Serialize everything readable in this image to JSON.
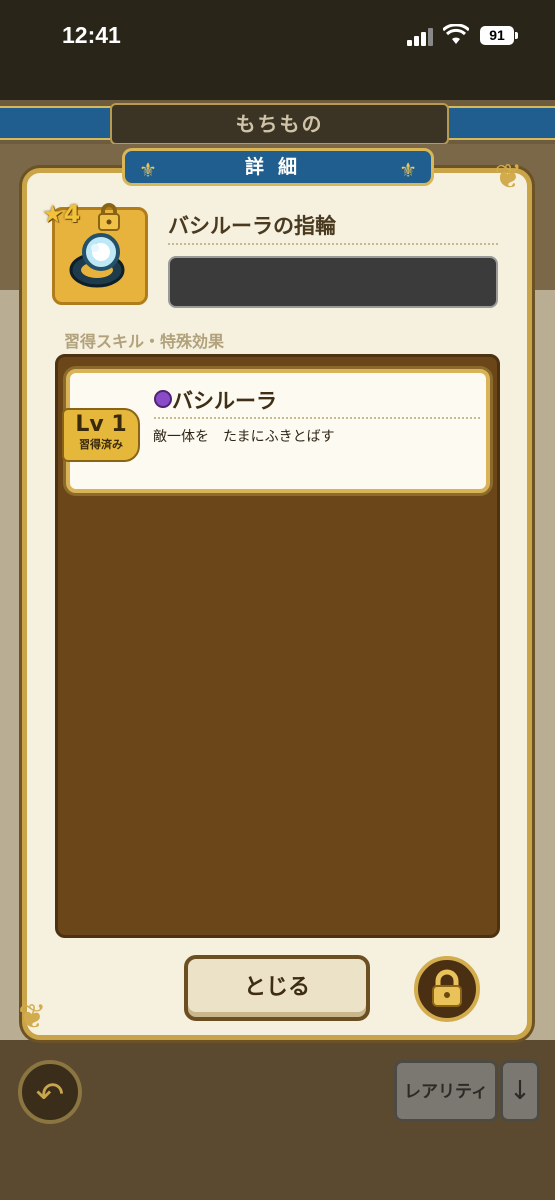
{
  "status": {
    "time": "12:41",
    "battery": "91"
  },
  "screen": {
    "title": "もちもの"
  },
  "modal": {
    "tab_title": "詳細",
    "item": {
      "rarity": "4",
      "name": "バシルーラの指輪"
    },
    "section_label": "習得スキル・特殊効果",
    "skill": {
      "level": "Lv 1",
      "status": "習得済み",
      "name": "バシルーラ",
      "description": "敵一体を　たまにふきとばす"
    },
    "close_label": "とじる"
  },
  "footer": {
    "sort_label": "レアリティ",
    "sort_arrow": "↓"
  },
  "colors": {
    "accent_gold": "#d8b357",
    "tab_blue": "#1f5e8e",
    "skill_panel": "#6b4619",
    "skill_icon": "#8a4bc8"
  }
}
